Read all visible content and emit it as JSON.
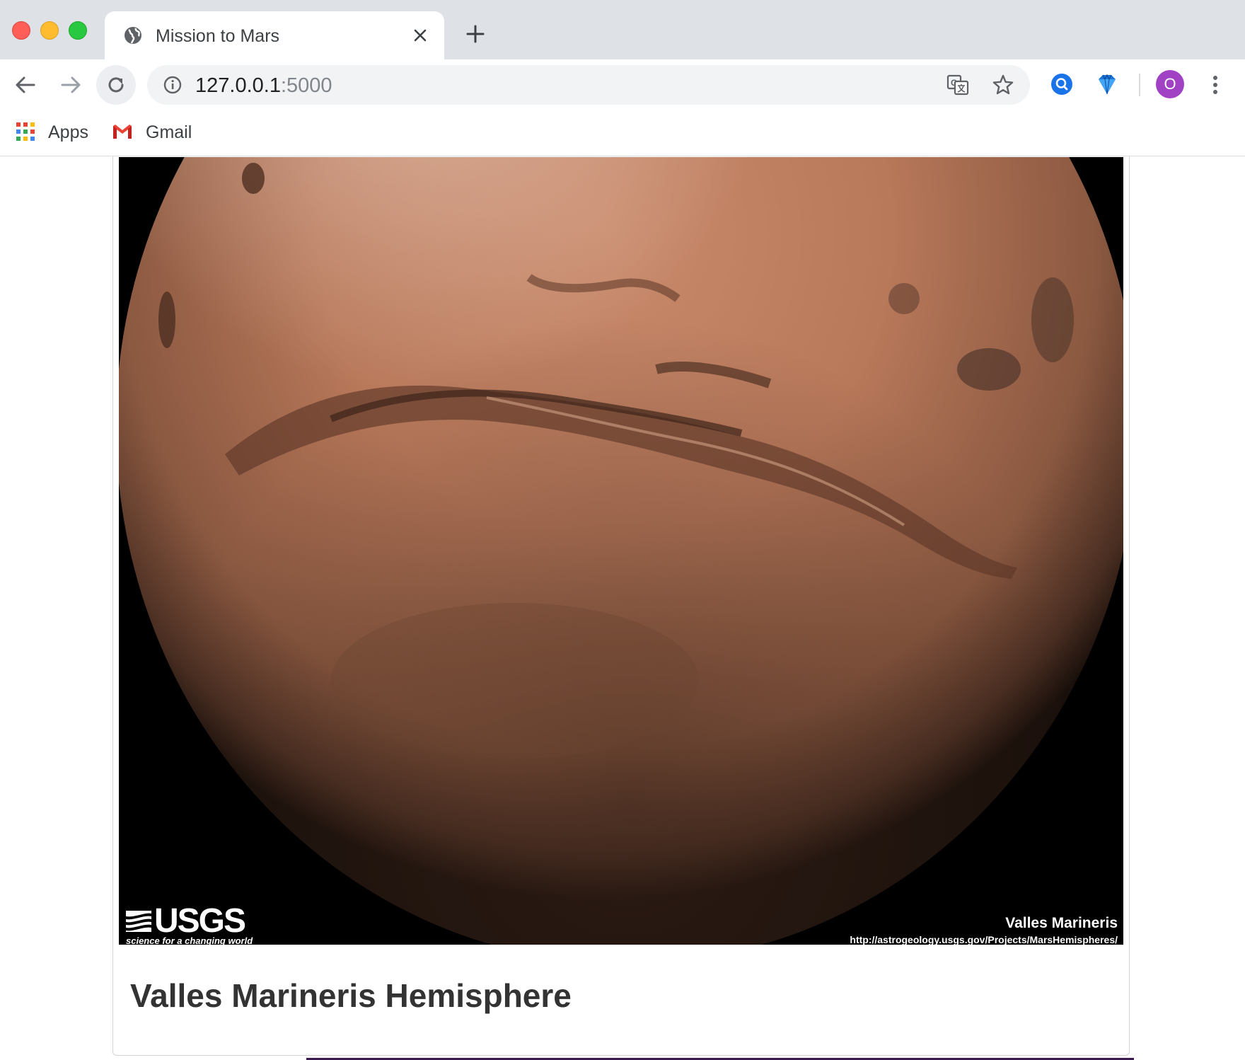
{
  "browser": {
    "tab": {
      "title": "Mission to Mars"
    },
    "address": {
      "host": "127.0.0.1",
      "port": ":5000"
    },
    "profile": {
      "initial": "O",
      "color": "#a142c4"
    },
    "bookmarks": [
      {
        "label": "Apps",
        "icon": "apps-grid-icon"
      },
      {
        "label": "Gmail",
        "icon": "gmail-icon"
      }
    ]
  },
  "page": {
    "hemisphere": {
      "title": "Valles Marineris Hemisphere",
      "image": {
        "logo_text": "USGS",
        "logo_tagline": "science for a changing world",
        "caption_name": "Valles Marineris",
        "caption_url": "http://astrogeology.usgs.gov/Projects/MarsHemispheres/"
      }
    }
  }
}
